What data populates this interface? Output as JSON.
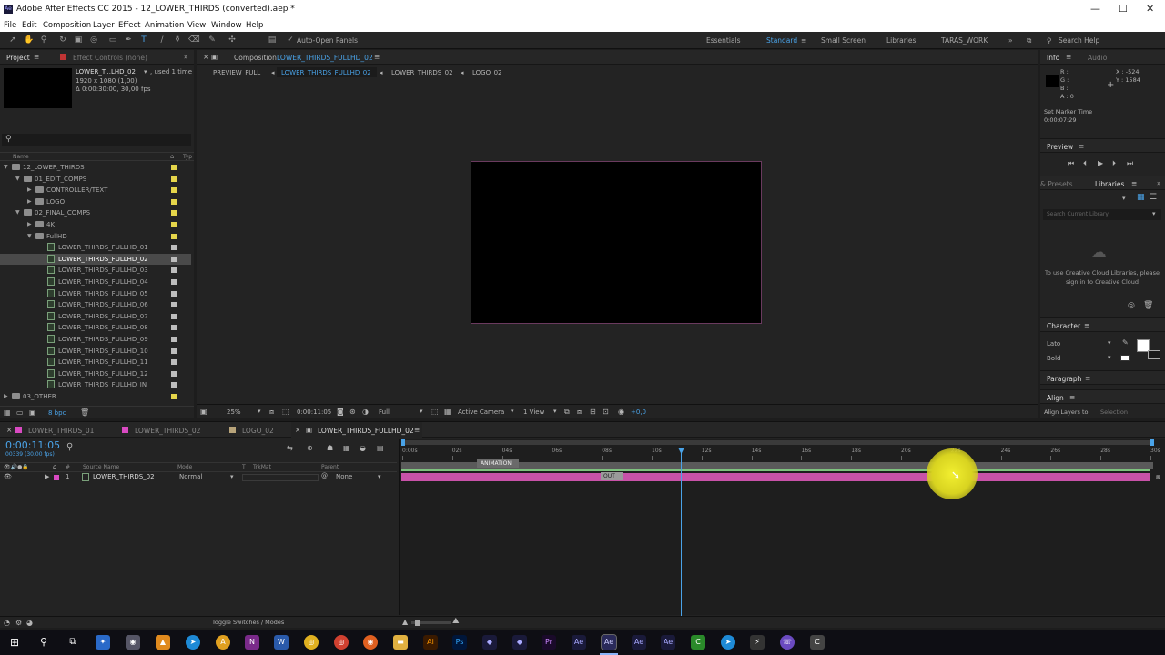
{
  "window": {
    "title": "Adobe After Effects CC 2015 - 12_LOWER_THIRDS (converted).aep *",
    "min": "—",
    "max": "☐",
    "close": "✕"
  },
  "menu": [
    "File",
    "Edit",
    "Composition",
    "Layer",
    "Effect",
    "Animation",
    "View",
    "Window",
    "Help"
  ],
  "toolbar": {
    "auto_open": "Auto-Open Panels",
    "workspaces": [
      "Essentials",
      "Standard",
      "Small Screen",
      "Libraries",
      "TARAS_WORK"
    ],
    "search_help": "Search Help"
  },
  "project": {
    "tab": "Project",
    "effect_controls": "Effect Controls (none)",
    "selected_name": "LOWER_T...LHD_02",
    "used": ", used 1 time",
    "dims": "1920 x 1080 (1,00)",
    "duration": "Δ 0:00:30:00, 30,00 fps",
    "col_name": "Name",
    "col_type": "Typ",
    "items": [
      {
        "label": "12_LOWER_THIRDS",
        "kind": "folder",
        "depth": 0,
        "open": true,
        "color": "#e5d54a"
      },
      {
        "label": "01_EDIT_COMPS",
        "kind": "folder",
        "depth": 1,
        "open": true,
        "color": "#e5d54a"
      },
      {
        "label": "CONTROLLER/TEXT",
        "kind": "folder",
        "depth": 2,
        "open": false,
        "color": "#e5d54a"
      },
      {
        "label": "LOGO",
        "kind": "folder",
        "depth": 2,
        "open": false,
        "color": "#e5d54a"
      },
      {
        "label": "02_FINAL_COMPS",
        "kind": "folder",
        "depth": 1,
        "open": true,
        "color": "#e5d54a"
      },
      {
        "label": "4K",
        "kind": "folder",
        "depth": 2,
        "open": false,
        "color": "#e5d54a"
      },
      {
        "label": "FullHD",
        "kind": "folder",
        "depth": 2,
        "open": true,
        "color": "#e5d54a"
      },
      {
        "label": "LOWER_THIRDS_FULLHD_01",
        "kind": "comp",
        "depth": 3,
        "color": "#bdbdbd"
      },
      {
        "label": "LOWER_THIRDS_FULLHD_02",
        "kind": "comp",
        "depth": 3,
        "color": "#bdbdbd",
        "selected": true
      },
      {
        "label": "LOWER_THIRDS_FULLHD_03",
        "kind": "comp",
        "depth": 3,
        "color": "#bdbdbd"
      },
      {
        "label": "LOWER_THIRDS_FULLHD_04",
        "kind": "comp",
        "depth": 3,
        "color": "#bdbdbd"
      },
      {
        "label": "LOWER_THIRDS_FULLHD_05",
        "kind": "comp",
        "depth": 3,
        "color": "#bdbdbd"
      },
      {
        "label": "LOWER_THIRDS_FULLHD_06",
        "kind": "comp",
        "depth": 3,
        "color": "#bdbdbd"
      },
      {
        "label": "LOWER_THIRDS_FULLHD_07",
        "kind": "comp",
        "depth": 3,
        "color": "#bdbdbd"
      },
      {
        "label": "LOWER_THIRDS_FULLHD_08",
        "kind": "comp",
        "depth": 3,
        "color": "#bdbdbd"
      },
      {
        "label": "LOWER_THIRDS_FULLHD_09",
        "kind": "comp",
        "depth": 3,
        "color": "#bdbdbd"
      },
      {
        "label": "LOWER_THIRDS_FULLHD_10",
        "kind": "comp",
        "depth": 3,
        "color": "#bdbdbd"
      },
      {
        "label": "LOWER_THIRDS_FULLHD_11",
        "kind": "comp",
        "depth": 3,
        "color": "#bdbdbd"
      },
      {
        "label": "LOWER_THIRDS_FULLHD_12",
        "kind": "comp",
        "depth": 3,
        "color": "#bdbdbd"
      },
      {
        "label": "LOWER_THIRDS_FULLHD_IN",
        "kind": "comp",
        "depth": 3,
        "color": "#bdbdbd"
      },
      {
        "label": "03_OTHER",
        "kind": "folder",
        "depth": 0,
        "open": false,
        "color": "#e5d54a"
      }
    ],
    "bpc": "8 bpc"
  },
  "comp": {
    "header_label": "Composition",
    "header_name": "LOWER_THIRDS_FULLHD_02",
    "flow": [
      "PREVIEW_FULL",
      "LOWER_THIRDS_FULLHD_02",
      "LOWER_THIRDS_02",
      "LOGO_02"
    ],
    "zoom": "25%",
    "time": "0:00:11:05",
    "resolution": "Full",
    "camera": "Active Camera",
    "views": "1 View",
    "exposure": "+0,0"
  },
  "info": {
    "tab": "Info",
    "audio": "Audio",
    "R": "R :",
    "G": "G :",
    "B": "B :",
    "A": "A : 0",
    "x": "X : -524",
    "y": "Y : 1584",
    "marker": "Set Marker Time",
    "marker_time": "0:00:07:29"
  },
  "preview": {
    "tab": "Preview"
  },
  "libraries": {
    "tab1": "& Presets",
    "tab2": "Libraries",
    "search": "Search Current Library",
    "msg": "To use Creative Cloud Libraries, please sign in to Creative Cloud"
  },
  "character": {
    "tab": "Character",
    "font": "Lato",
    "style": "Bold"
  },
  "paragraph": {
    "tab": "Paragraph"
  },
  "align": {
    "tab": "Align",
    "layers_to": "Align Layers to:",
    "selection": "Selection"
  },
  "timeline": {
    "tabs": [
      "LOWER_THIRDS_01",
      "LOWER_THIRDS_02",
      "LOGO_02",
      "LOWER_THIRDS_FULLHD_02"
    ],
    "tab_colors": [
      "#d94ac2",
      "#d94ac2",
      "#b8a47a",
      "#aaaaaa"
    ],
    "timecode": "0:00:11:05",
    "frames": "00339 (30.00 fps)",
    "col_num": "#",
    "col_source": "Source Name",
    "col_mode": "Mode",
    "col_t": "T",
    "col_trk": "TrkMat",
    "col_parent": "Parent",
    "layer": {
      "num": "1",
      "name": "LOWER_THIRDS_02",
      "mode": "Normal",
      "parent": "None"
    },
    "ruler": [
      "0:00s",
      "02s",
      "04s",
      "06s",
      "08s",
      "10s",
      "12s",
      "14s",
      "16s",
      "18s",
      "20s",
      "22s",
      "24s",
      "26s",
      "28s",
      "30s"
    ],
    "markers": [
      "ANIMATION",
      "OUT"
    ],
    "toggle": "Toggle Switches / Modes"
  },
  "colors": {
    "bar_pink": "#c852a8",
    "playhead": "#4aa3e8",
    "accent_blue": "#4aa3e8"
  }
}
